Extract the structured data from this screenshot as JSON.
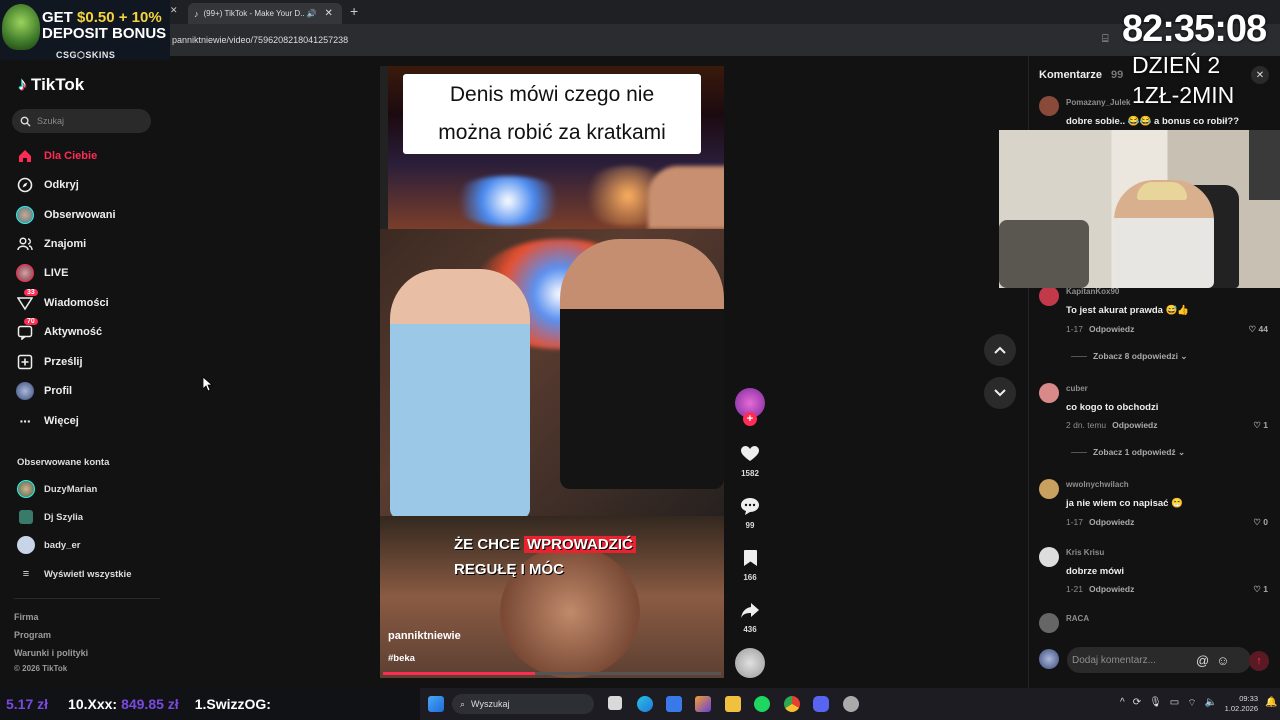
{
  "browser": {
    "tab_title": "(99+) TikTok - Make Your D...",
    "url": "panniktniewie/video/7596208218041257238"
  },
  "promo": {
    "line1_a": "GET ",
    "line1_b": "$0.50 + 10%",
    "line2": "DEPOSIT BONUS",
    "brand": "CSG⬡SKINS"
  },
  "sidebar": {
    "logo": "TikTok",
    "search_placeholder": "Szukaj",
    "nav": [
      {
        "label": "Dla Ciebie",
        "icon": "home-icon"
      },
      {
        "label": "Odkryj",
        "icon": "compass-icon"
      },
      {
        "label": "Obserwowani",
        "icon": "avatar-icon"
      },
      {
        "label": "Znajomi",
        "icon": "friends-icon"
      },
      {
        "label": "LIVE",
        "icon": "live-icon"
      },
      {
        "label": "Wiadomości",
        "icon": "message-icon",
        "badge": "33"
      },
      {
        "label": "Aktywność",
        "icon": "activity-icon",
        "badge": "70"
      },
      {
        "label": "Prześlij",
        "icon": "upload-icon"
      },
      {
        "label": "Profil",
        "icon": "profile-icon"
      },
      {
        "label": "Więcej",
        "icon": "more-icon"
      }
    ],
    "followed_title": "Obserwowane konta",
    "followed": [
      {
        "name": "DuzyMarian",
        "color": "#6a8a5a"
      },
      {
        "name": "Dj Szylia",
        "color": "#3a7a6a"
      },
      {
        "name": "bady_er",
        "color": "#c8d4e8"
      },
      {
        "name": "Wyświetl wszystkie",
        "color": ""
      }
    ],
    "footer": [
      "Firma",
      "Program",
      "Warunki i polityki",
      "© 2026 TikTok"
    ]
  },
  "video": {
    "title_line1": "Denis mówi czego nie",
    "title_line2": "można robić za kratkami",
    "subtitle_line1_a": "ŻE CHCE ",
    "subtitle_line1_b": "WPROWADZIĆ",
    "subtitle_line2": "REGUŁĘ I MÓC",
    "author": "panniktniewie",
    "tag": "#beka",
    "progress": 0.45
  },
  "actions": {
    "likes": "1582",
    "comments": "99",
    "saves": "166",
    "shares": "436"
  },
  "comments": {
    "title": "Komentarze",
    "count": "99",
    "input_placeholder": "Dodaj komentarz...",
    "items": [
      {
        "user": "Pomazany_Julek",
        "text": "dobre sobie.. 😂😂 a bonus co robił??",
        "meta": "",
        "likes": "",
        "av": "#8a4a3a"
      },
      {
        "user": "KapitanKox90",
        "text": "To jest akurat prawda 😅👍",
        "meta": "1-17",
        "reply": "Odpowiedz",
        "likes": "44",
        "av": "#c23a4a"
      },
      {
        "user": "cuber",
        "text": "co kogo to obchodzi",
        "meta": "2 dn. temu",
        "reply": "Odpowiedz",
        "likes": "1",
        "av": "#d88a8a"
      },
      {
        "user": "wwolnychwilach",
        "text": "ja nie wiem co napisać 😁",
        "meta": "1-17",
        "reply": "Odpowiedz",
        "likes": "0",
        "av": "#c8a060"
      },
      {
        "user": "Kris Krisu",
        "text": "dobrze mówi",
        "meta": "1-21",
        "reply": "Odpowiedz",
        "likes": "1",
        "av": "#dddddd"
      },
      {
        "user": "RACA",
        "text": "",
        "meta": "",
        "likes": "",
        "av": "#666666"
      }
    ],
    "replies": [
      "Zobacz 8 odpowiedzi",
      "Zobacz 1 odpowiedź"
    ]
  },
  "overlay": {
    "timer": "82:35:08",
    "day": "DZIEŃ 2",
    "rate": "1ZŁ-2MIN"
  },
  "ticker": {
    "a": "5.17 zł",
    "b_label": "10.Xxx:",
    "b_value": "849.85 zł",
    "c": "1.SwizzOG:"
  },
  "taskbar": {
    "search": "Wyszukaj",
    "time": "09:33",
    "date": "1.02.2026"
  }
}
